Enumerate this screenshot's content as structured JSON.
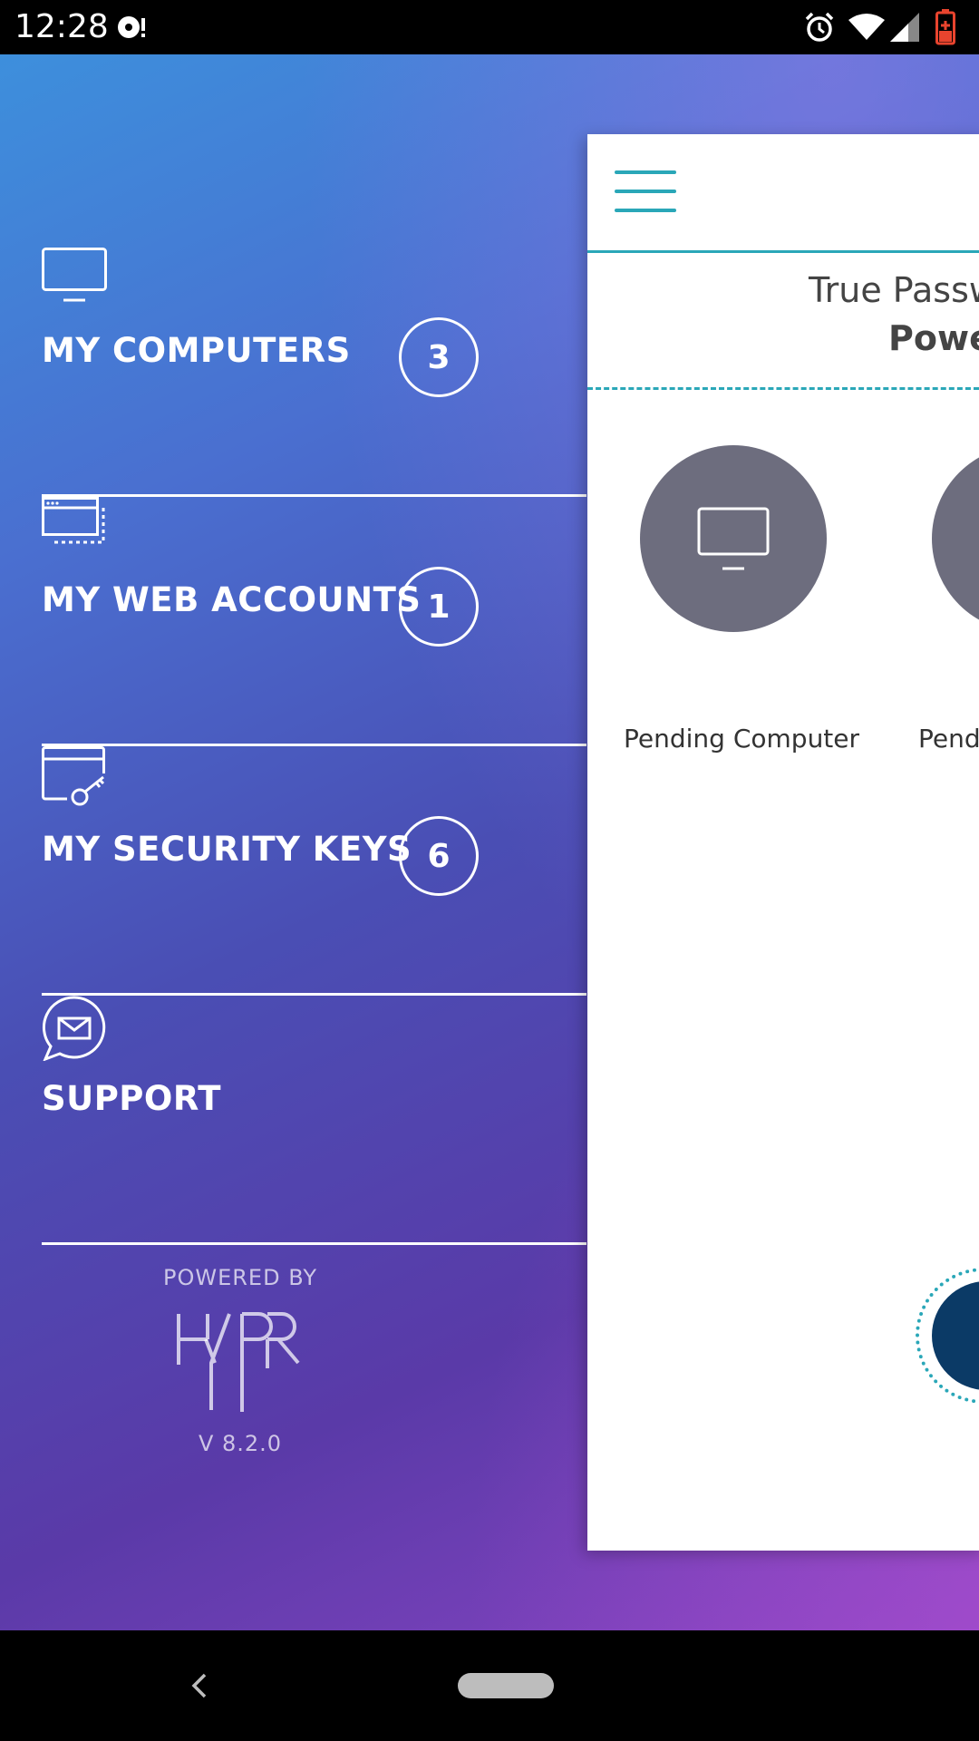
{
  "status_bar": {
    "time": "12:28"
  },
  "menu": {
    "items": [
      {
        "label": "MY COMPUTERS",
        "count": "3",
        "icon": "monitor-icon"
      },
      {
        "label": "MY WEB ACCOUNTS",
        "count": "1",
        "icon": "browser-window-icon"
      },
      {
        "label": "MY SECURITY KEYS",
        "count": "6",
        "icon": "security-key-icon"
      },
      {
        "label": "SUPPORT",
        "icon": "chat-mail-icon"
      }
    ],
    "powered_by": "POWERED BY",
    "logo": "HYPR",
    "version": "V  8.2.0"
  },
  "card": {
    "title_line1": "True Passw",
    "title_line2": "Power",
    "tiles": [
      {
        "label": "Pending Computer",
        "icon": "monitor-icon"
      },
      {
        "label": "Pendi",
        "icon": "monitor-icon"
      }
    ]
  },
  "colors": {
    "accent": "#2aa7b8",
    "tile_circle": "#6d6d7e",
    "fab": "#0b3a66"
  }
}
